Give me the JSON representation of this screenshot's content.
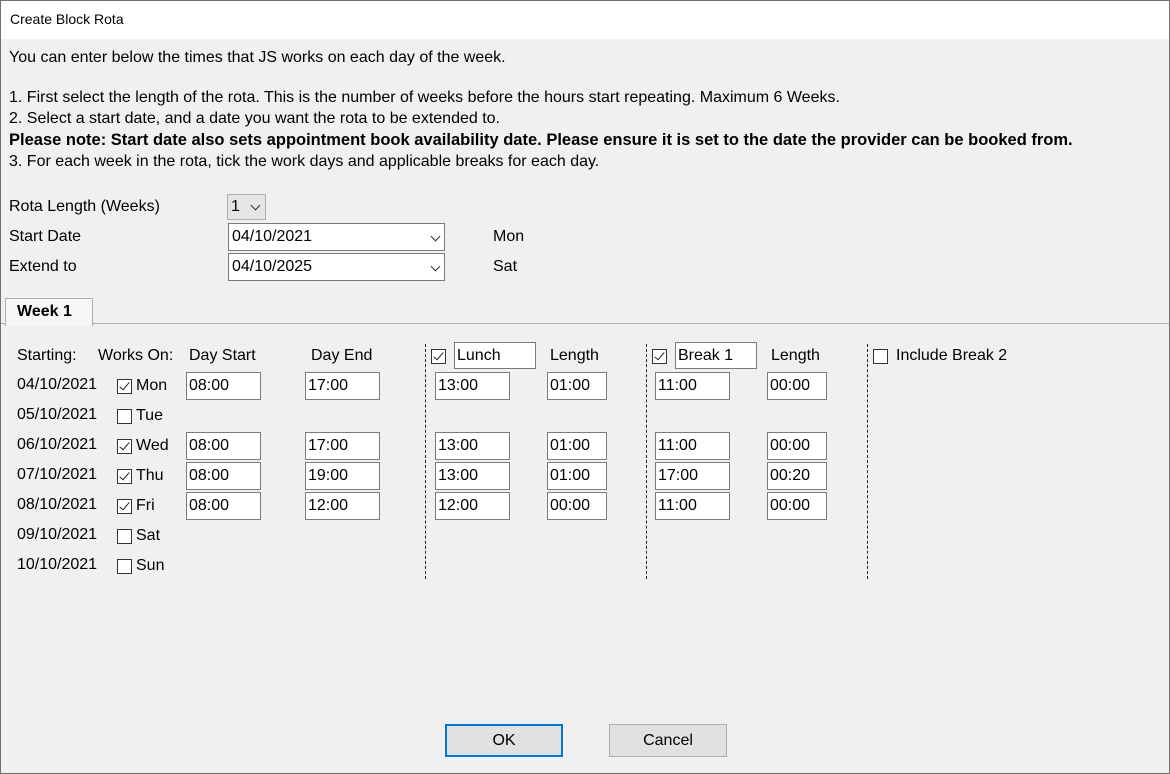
{
  "window": {
    "title": "Create Block Rota"
  },
  "instructions": {
    "intro": "You can enter below the times that JS works on each day of the week.",
    "step1": "1. First select the length of the rota. This is the number of weeks before the hours start repeating. Maximum 6 Weeks.",
    "step2": "2. Select a start date, and a date you want the rota to be extended to.",
    "note": "Please note: Start date also sets appointment book availability date. Please ensure it is set to the date the provider can be booked from.",
    "step3": "3. For each week in the rota, tick the work days and applicable breaks for each day."
  },
  "settings": {
    "rota_length_label": "Rota Length (Weeks)",
    "rota_length_value": "1",
    "start_date_label": "Start Date",
    "start_date_value": "04/10/2021",
    "start_day": "Mon",
    "extend_label": "Extend to",
    "extend_value": "04/10/2025",
    "extend_day": "Sat"
  },
  "tab": {
    "label": "Week 1"
  },
  "headers": {
    "starting": "Starting:",
    "works_on": "Works On:",
    "day_start": "Day Start",
    "day_end": "Day End",
    "lunch_name": "Lunch",
    "lunch_length": "Length",
    "break1_name": "Break 1",
    "break1_length": "Length",
    "include_break2": "Include Break 2"
  },
  "days": [
    {
      "date": "04/10/2021",
      "day": "Mon",
      "works": true,
      "start": "08:00",
      "end": "17:00",
      "lunch": "13:00",
      "lunch_len": "01:00",
      "break1": "11:00",
      "break1_len": "00:00"
    },
    {
      "date": "05/10/2021",
      "day": "Tue",
      "works": false
    },
    {
      "date": "06/10/2021",
      "day": "Wed",
      "works": true,
      "start": "08:00",
      "end": "17:00",
      "lunch": "13:00",
      "lunch_len": "01:00",
      "break1": "11:00",
      "break1_len": "00:00"
    },
    {
      "date": "07/10/2021",
      "day": "Thu",
      "works": true,
      "start": "08:00",
      "end": "19:00",
      "lunch": "13:00",
      "lunch_len": "01:00",
      "break1": "17:00",
      "break1_len": "00:20"
    },
    {
      "date": "08/10/2021",
      "day": "Fri",
      "works": true,
      "start": "08:00",
      "end": "12:00",
      "lunch": "12:00",
      "lunch_len": "00:00",
      "break1": "11:00",
      "break1_len": "00:00"
    },
    {
      "date": "09/10/2021",
      "day": "Sat",
      "works": false
    },
    {
      "date": "10/10/2021",
      "day": "Sun",
      "works": false
    }
  ],
  "buttons": {
    "ok": "OK",
    "cancel": "Cancel"
  }
}
